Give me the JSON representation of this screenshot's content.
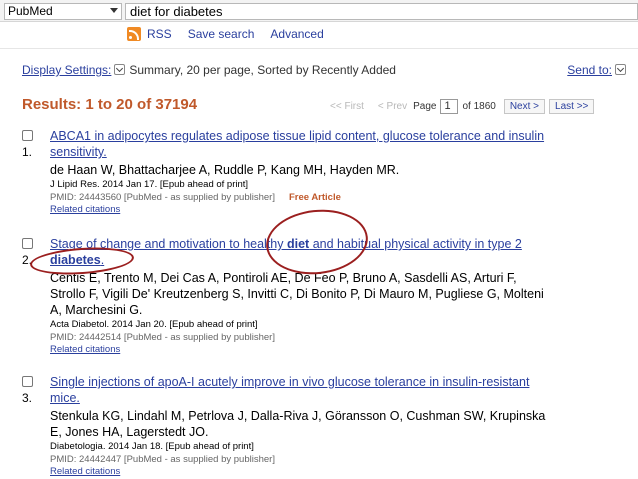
{
  "search": {
    "database": "PubMed",
    "query": "diet for diabetes",
    "links": [
      "RSS",
      "Save search",
      "Advanced"
    ]
  },
  "display": {
    "settings_label": "Display Settings:",
    "settings_value": "Summary, 20 per page, Sorted by Recently Added",
    "send_to_label": "Send to:"
  },
  "results": {
    "header": "Results: 1 to 20 of 37194",
    "pager": {
      "first": "<< First",
      "prev": "< Prev",
      "page_label": "Page",
      "page_value": "1",
      "of_total": "of 1860",
      "next": "Next >",
      "last": "Last >>"
    },
    "items": [
      {
        "num": "1.",
        "title_line1": "ABCA1 in adipocytes regulates adipose tissue lipid content, glucose tolerance and insulin",
        "title_line2": "sensitivity.",
        "authors": "de Haan W, Bhattacharjee A, Ruddle P, Kang MH, Hayden MR.",
        "journal": "J Lipid Res. 2014 Jan 17. [Epub ahead of print]",
        "pmid": "PMID: 24443560 [PubMed - as supplied by publisher]",
        "free": "Free Article",
        "related": "Related citations"
      },
      {
        "num": "2.",
        "title_pre": "Stage of change and motivation to healthy ",
        "title_bold1": "diet",
        "title_post": " and habitual physical activity in type 2",
        "title_bold2": "diabetes",
        "title_end": ".",
        "authors_l1": "Centis E, Trento M, Dei Cas A, Pontiroli AE, De Feo P, Bruno A, Sasdelli AS, Arturi F,",
        "authors_l2": "Strollo F, Vigili De' Kreutzenberg S, Invitti C, Di Bonito P, Di Mauro M, Pugliese G, Molteni",
        "authors_l3": "A, Marchesini G.",
        "journal": "Acta Diabetol. 2014 Jan 20. [Epub ahead of print]",
        "pmid": "PMID: 24442514 [PubMed - as supplied by publisher]",
        "related": "Related citations"
      },
      {
        "num": "3.",
        "title_line1": "Single injections of apoA-I acutely improve in vivo glucose tolerance in insulin-resistant",
        "title_line2": "mice.",
        "authors_l1": "Stenkula KG, Lindahl M, Petrlova J, Dalla-Riva J, Göransson O, Cushman SW, Krupinska",
        "authors_l2": "E, Jones HA, Lagerstedt JO.",
        "journal": "Diabetologia. 2014 Jan 18. [Epub ahead of print]",
        "pmid": "PMID: 24442447 [PubMed - as supplied by publisher]",
        "related": "Related citations"
      }
    ]
  },
  "colors": {
    "link": "#2a3f9e",
    "results_header": "#c0592b",
    "annotation": "#9b1f1f",
    "rss": "#f08a24"
  }
}
